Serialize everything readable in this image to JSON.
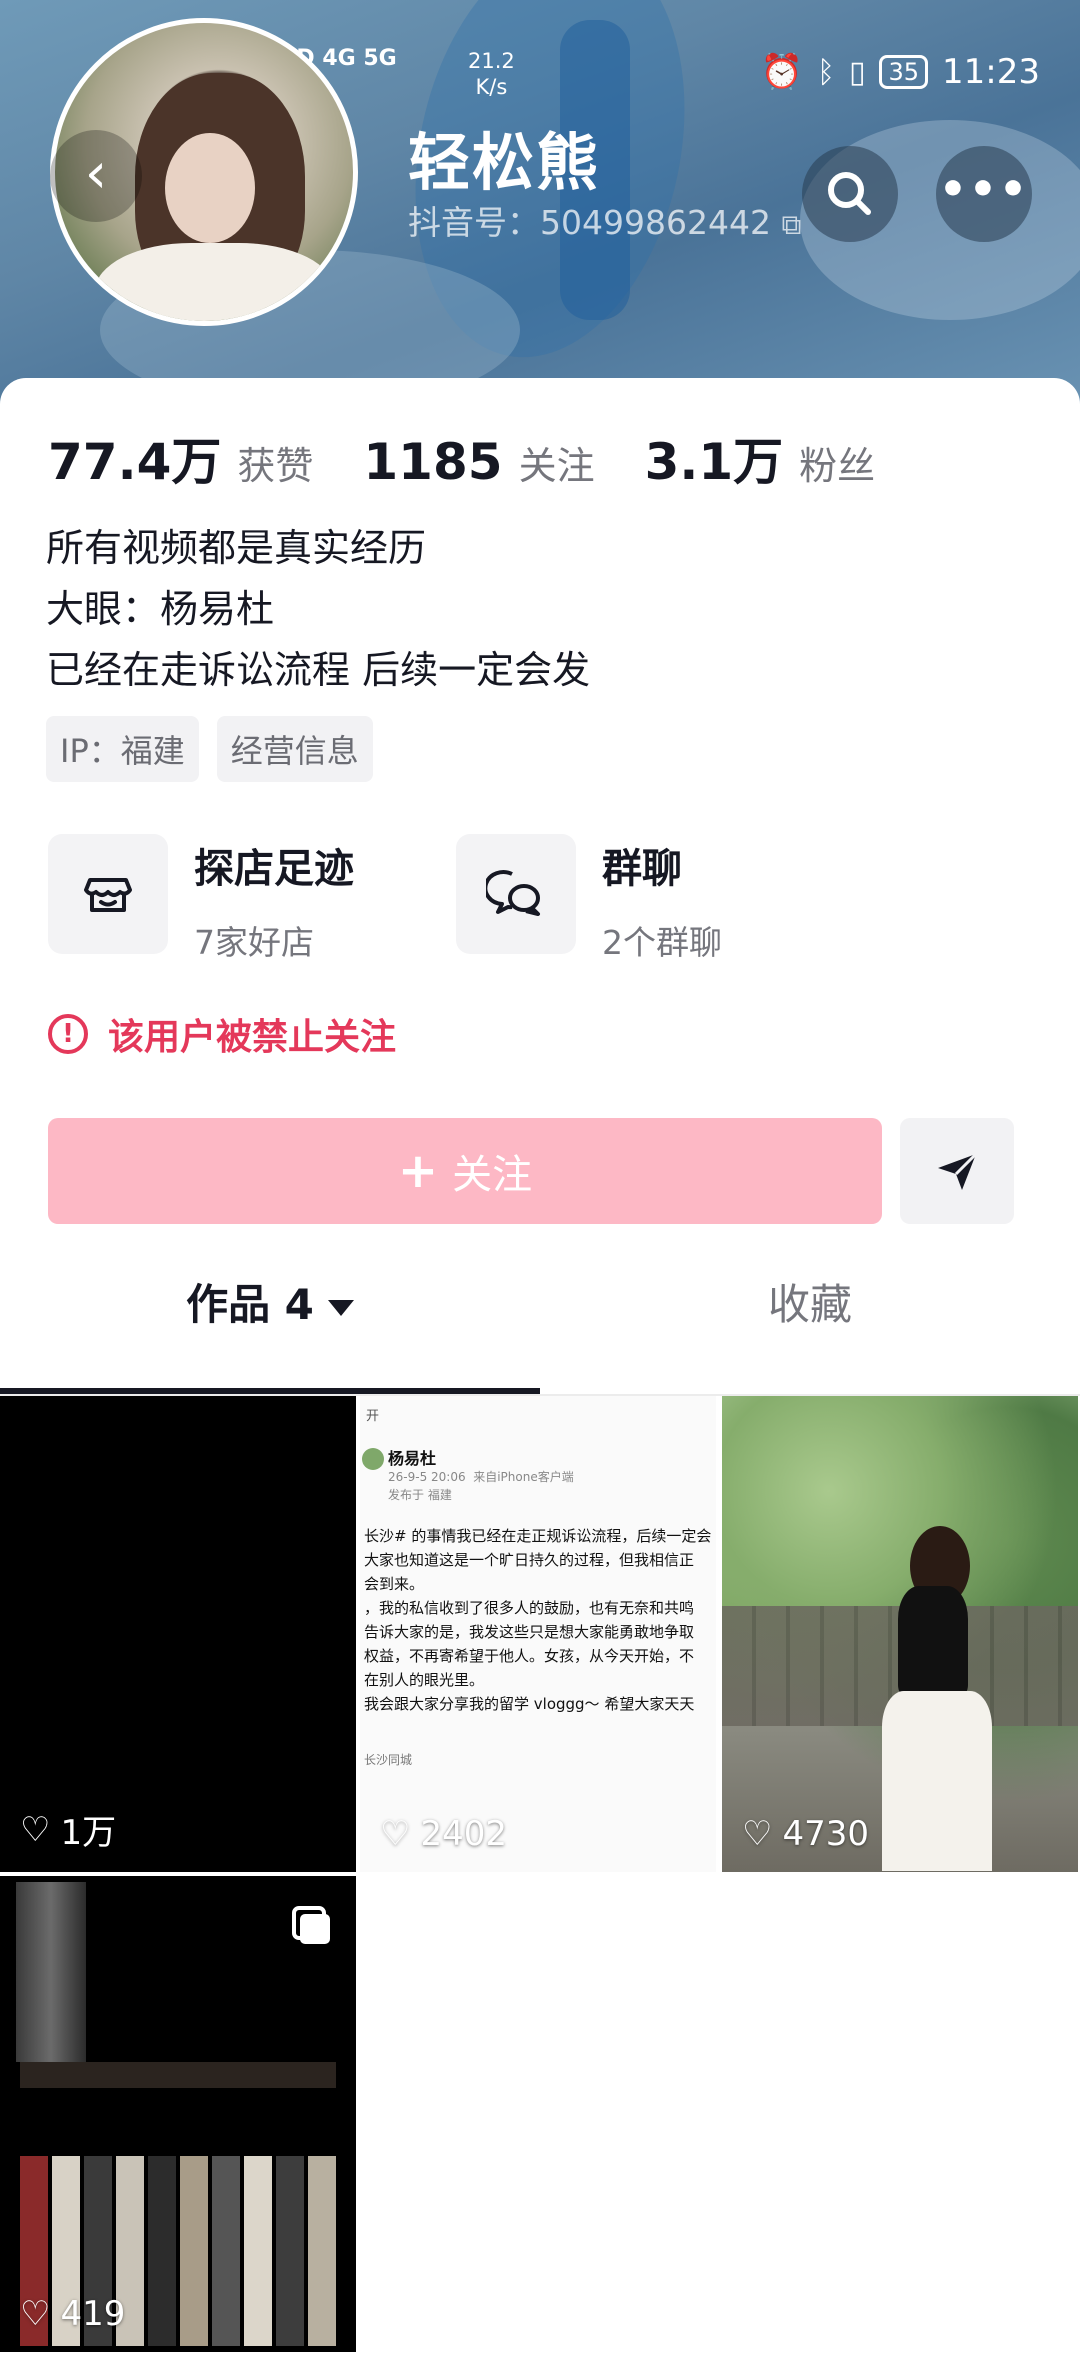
{
  "status_bar": {
    "network": "HD 4G 5G",
    "speed": "21.2\nK/s",
    "battery": "35",
    "time": "11:23"
  },
  "profile": {
    "nickname": "轻松熊",
    "douyin_id": "抖音号：50499862442",
    "stats": [
      {
        "value": "77.4万",
        "label": "获赞"
      },
      {
        "value": "1185",
        "label": "关注"
      },
      {
        "value": "3.1万",
        "label": "粉丝"
      }
    ],
    "bio_lines": [
      "所有视频都是真实经历",
      "大眼：杨易杜",
      "已经在走诉讼流程 后续一定会发"
    ],
    "tags": [
      "IP：福建",
      "经营信息"
    ],
    "features": [
      {
        "title": "探店足迹",
        "sub": "7家好店",
        "icon": "shop-icon"
      },
      {
        "title": "群聊",
        "sub": "2个群聊",
        "icon": "chat-bubbles-icon"
      }
    ],
    "warning": "该用户被禁止关注",
    "follow_label": "关注"
  },
  "tabs": {
    "works": "作品 4",
    "favorites": "收藏"
  },
  "posts": [
    {
      "likes": "1万"
    },
    {
      "likes": "2402",
      "screenshot": {
        "open": "开",
        "author": "杨易杜",
        "meta": "26-9-5 20:06  来自iPhone客户端\n发布于 福建",
        "body": "长沙# 的事情我已经在走正规诉讼流程，后续一定会\n大家也知道这是一个旷日持久的过程，但我相信正\n会到来。\n，我的私信收到了很多人的鼓励，也有无奈和共鸣\n告诉大家的是，我发这些只是想大家能勇敢地争取\n权益，不再寄希望于他人。女孩，从今天开始，不\n在别人的眼光里。\n我会跟大家分享我的留学 vloggg～ 希望大家天天",
        "location": "长沙同城"
      }
    },
    {
      "likes": "4730"
    },
    {
      "likes": "419"
    }
  ]
}
